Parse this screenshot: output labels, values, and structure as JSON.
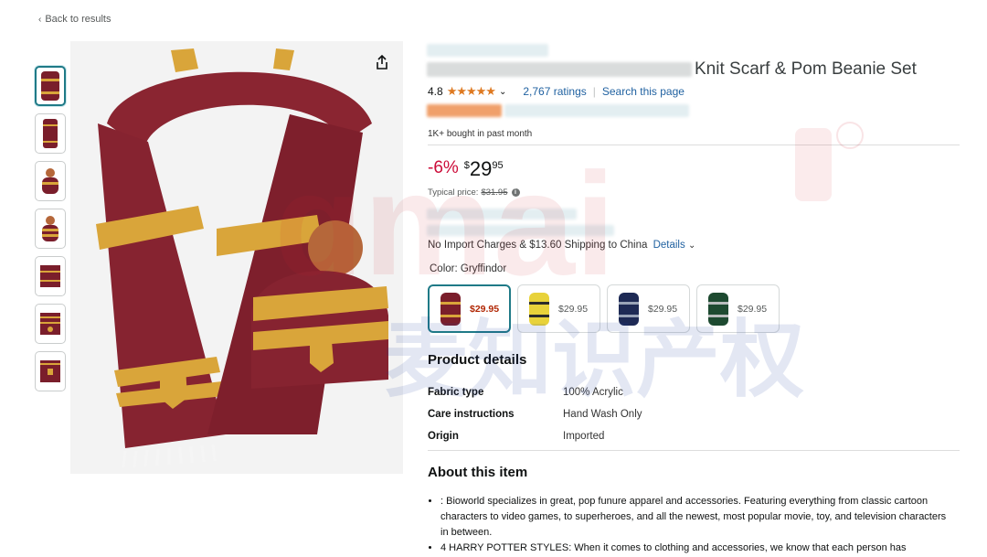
{
  "nav": {
    "back_label": "Back to results"
  },
  "product": {
    "title_visible": "Knit Scarf & Pom Beanie Set",
    "rating": "4.8",
    "stars": "★★★★★",
    "ratings_count": "2,767 ratings",
    "search_link": "Search this page",
    "separator": "|",
    "bought": "1K+ bought in past month",
    "discount": "-6%",
    "price_symbol": "$",
    "price_whole": "29",
    "price_fraction": "95",
    "typical_label": "Typical price:",
    "typical_price": "$31.95",
    "shipping_text": "No Import Charges & $13.60 Shipping to China",
    "shipping_link": "Details",
    "color_label": "Color: Gryffindor"
  },
  "swatches": [
    {
      "price": "$29.95",
      "house": "Gryffindor",
      "c1": "#7a1e2b",
      "c2": "#d9a53a",
      "selected": true
    },
    {
      "price": "$29.95",
      "house": "Hufflepuff",
      "c1": "#e8d23a",
      "c2": "#2b2b2b",
      "selected": false
    },
    {
      "price": "$29.95",
      "house": "Ravenclaw",
      "c1": "#1e2a55",
      "c2": "#9aa4b8",
      "selected": false
    },
    {
      "price": "$29.95",
      "house": "Slytherin",
      "c1": "#1d4a30",
      "c2": "#b9bdbd",
      "selected": false
    }
  ],
  "product_details": {
    "heading": "Product details",
    "rows": [
      {
        "k": "Fabric type",
        "v": "100% Acrylic"
      },
      {
        "k": "Care instructions",
        "v": "Hand Wash Only"
      },
      {
        "k": "Origin",
        "v": "Imported"
      }
    ]
  },
  "about": {
    "heading": "About this item",
    "bullets": [
      ": Bioworld specializes in great, pop funure apparel and accessories. Featuring everything from classic cartoon characters to video games, to superheroes, and all the newest, most popular movie, toy, and television characters in between.",
      "4 HARRY POTTER STYLES: When it comes to clothing and accessories, we know that each person has"
    ]
  },
  "colors": {
    "link": "#2162a1",
    "deal": "#cc0c39",
    "star": "#de7921",
    "accent": "#1f7a87",
    "maroon": "#7a1e2b",
    "gold": "#d9a53a"
  }
}
